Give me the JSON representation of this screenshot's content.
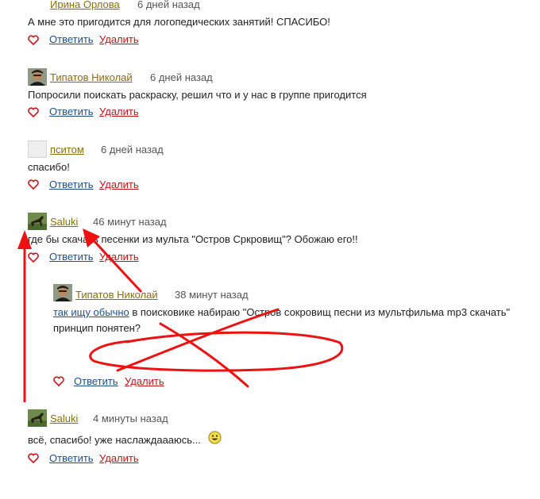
{
  "comments": [
    {
      "author": "Ирина Орлова",
      "time": "6 дней назад",
      "text": "А мне это пригодится для логопедических занятий! СПАСИБО!",
      "reply_label": "Ответить",
      "delete_label": "Удалить"
    },
    {
      "author": "Типатов Николай",
      "time": "6 дней назад",
      "text": "Попросили поискать раскраску, решил что и у нас в группе пригодится",
      "reply_label": "Ответить",
      "delete_label": "Удалить",
      "avatar": "user-photo-avatar"
    },
    {
      "author": "пситом",
      "time": "6 дней назад",
      "text": "спасибо!",
      "reply_label": "Ответить",
      "delete_label": "Удалить",
      "avatar": "default-avatar"
    },
    {
      "author": "Saluki",
      "time": "46 минут назад",
      "text": "где бы скачать песенки из мульта \"Остров Сркровищ\"? Обожаю его!!",
      "reply_label": "Ответить",
      "delete_label": "Удалить",
      "avatar": "horse-avatar"
    },
    {
      "author": "Типатов Николай",
      "time": "38 минут назад",
      "link_text": "так ищу обычно",
      "text_after_link": " в поисковике набираю \"Остров сокровищ песни из мультфильма mp3 скачать\"",
      "text_line2": "принцип понятен?",
      "reply_label": "Ответить",
      "delete_label": "Удалить",
      "avatar": "user-photo-avatar",
      "is_reply": true
    },
    {
      "author": "Saluki",
      "time": "4 минуты назад",
      "text": "всё, спасибо! уже наслаждаааюсь...",
      "reply_label": "Ответить",
      "delete_label": "Удалить",
      "avatar": "horse-avatar",
      "emoticon": "smiley-icon"
    }
  ],
  "colors": {
    "author_link": "#8a6d0b",
    "reply_link": "#1f4e8c",
    "delete_link": "#c0161a",
    "heart": "#d0141c",
    "annotation": "#ee1111"
  }
}
